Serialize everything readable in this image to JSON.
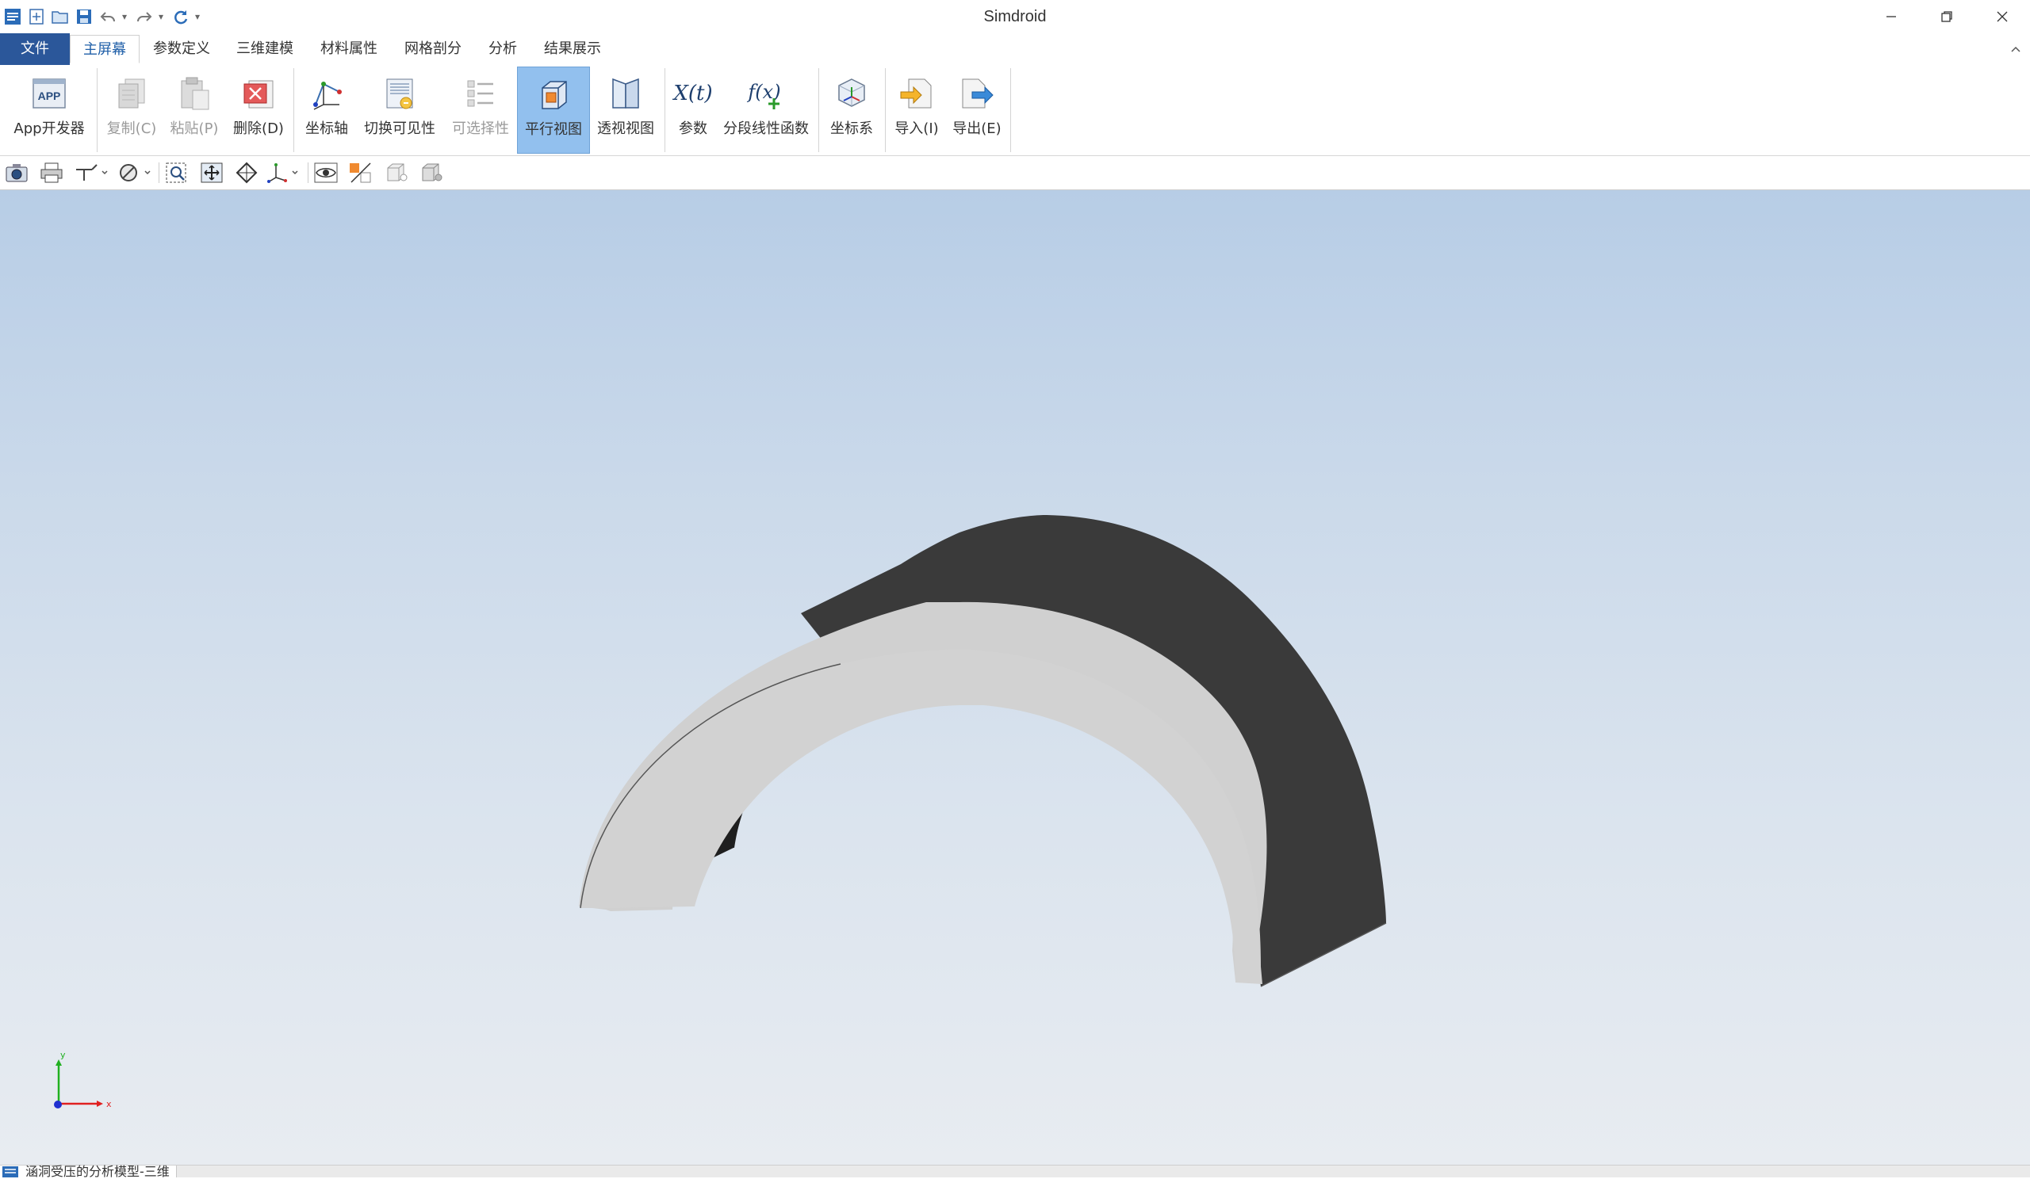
{
  "app": {
    "title": "Simdroid"
  },
  "quick_access": {
    "icons": [
      "app-logo-icon",
      "new-file-icon",
      "open-folder-icon",
      "save-icon",
      "undo-icon",
      "redo-icon",
      "refresh-icon",
      "customize-icon"
    ]
  },
  "menu": {
    "file": "文件",
    "tabs": [
      "主屏幕",
      "参数定义",
      "三维建模",
      "材料属性",
      "网格剖分",
      "分析",
      "结果展示"
    ],
    "active_tab": "主屏幕"
  },
  "ribbon": {
    "buttons": [
      {
        "label": "App开发器",
        "icon": "app-developer-icon",
        "enabled": true
      },
      {
        "label": "复制(C)",
        "icon": "copy-icon",
        "enabled": false
      },
      {
        "label": "粘贴(P)",
        "icon": "paste-icon",
        "enabled": false
      },
      {
        "label": "删除(D)",
        "icon": "delete-icon",
        "enabled": true
      },
      {
        "label": "坐标轴",
        "icon": "coordinate-axis-icon",
        "enabled": true
      },
      {
        "label": "切换可见性",
        "icon": "toggle-visibility-icon",
        "enabled": true
      },
      {
        "label": "可选择性",
        "icon": "selectability-icon",
        "enabled": false
      },
      {
        "label": "平行视图",
        "icon": "parallel-view-icon",
        "enabled": true,
        "selected": true
      },
      {
        "label": "透视视图",
        "icon": "perspective-view-icon",
        "enabled": true
      },
      {
        "label": "参数",
        "icon": "parameters-icon",
        "icon_text": "X(t)",
        "enabled": true
      },
      {
        "label": "分段线性函数",
        "icon": "piecewise-function-icon",
        "icon_text": "f(x)",
        "enabled": true
      },
      {
        "label": "坐标系",
        "icon": "coordinate-system-icon",
        "enabled": true
      },
      {
        "label": "导入(I)",
        "icon": "import-icon",
        "enabled": true
      },
      {
        "label": "导出(E)",
        "icon": "export-icon",
        "enabled": true
      }
    ]
  },
  "graphics_toolbar": {
    "icons": [
      "screenshot-icon",
      "print-icon",
      "axis-triad-icon",
      "render-mode-icon",
      "zoom-box-icon",
      "zoom-fit-icon",
      "rotate-view-icon",
      "view-orientation-icon",
      "show-hide-icon",
      "transparency-icon",
      "light-box-icon",
      "shadow-box-icon"
    ]
  },
  "viewport": {
    "model": "arch-tunnel",
    "axis_labels": {
      "x": "x",
      "y": "y"
    },
    "colors": {
      "outer_face": "#3a3a3a",
      "inner_face": "#2a2a2a",
      "front_face": "#d0d0d0",
      "x_axis": "#e02020",
      "y_axis": "#20b020",
      "z_axis": "#2030d0"
    }
  },
  "status": {
    "doc_tab": "涵洞受压的分析模型-三维"
  }
}
